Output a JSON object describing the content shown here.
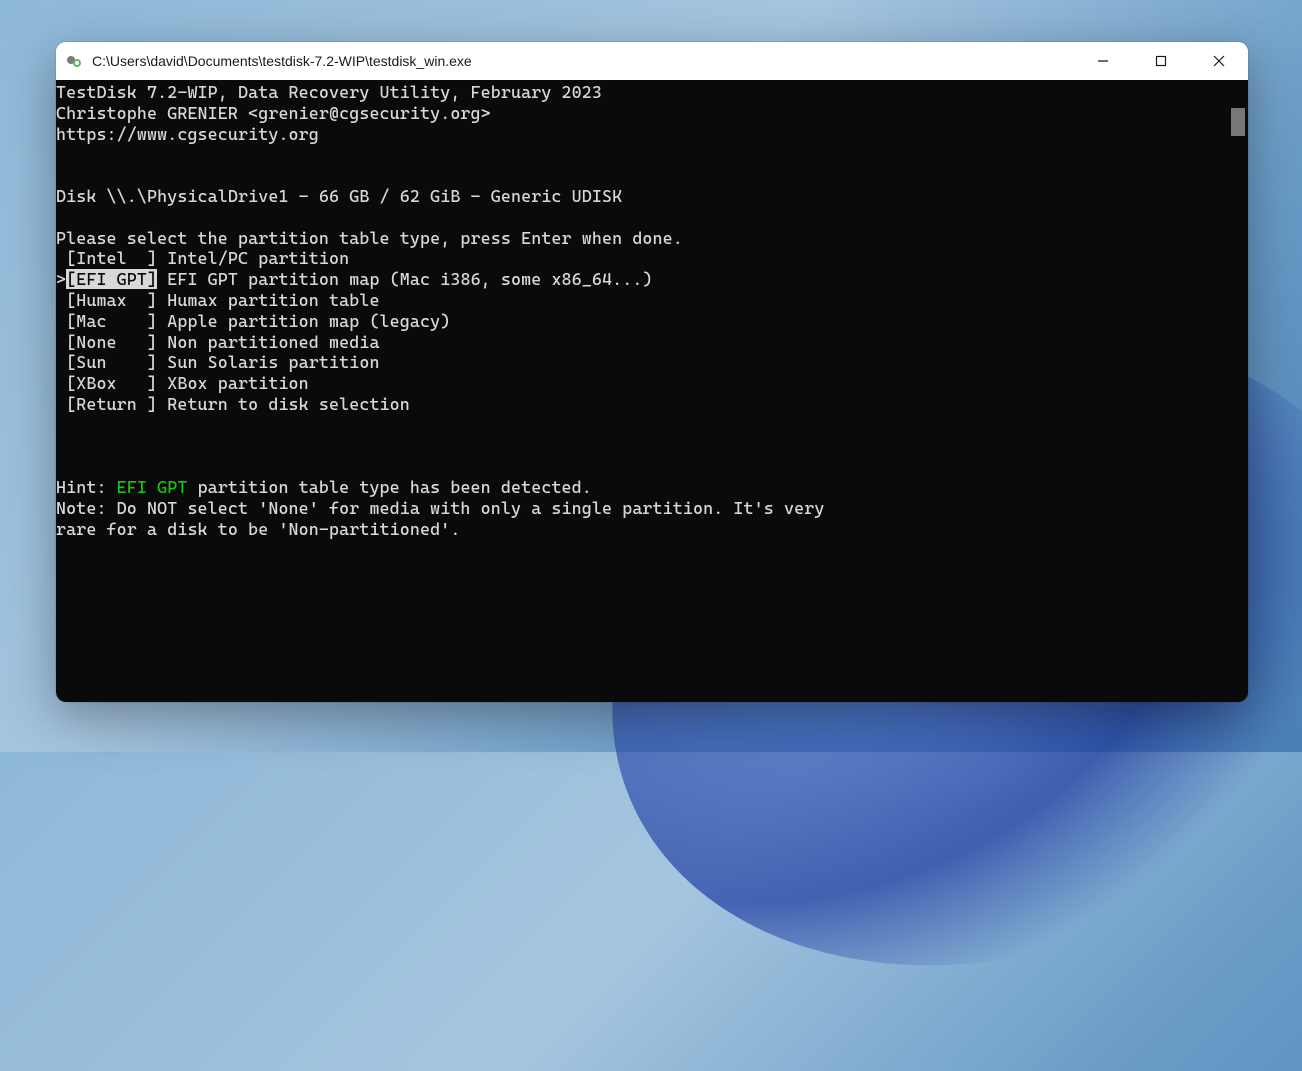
{
  "window": {
    "title": "C:\\Users\\david\\Documents\\testdisk-7.2-WIP\\testdisk_win.exe"
  },
  "header_lines": [
    "TestDisk 7.2-WIP, Data Recovery Utility, February 2023",
    "Christophe GRENIER <grenier@cgsecurity.org>",
    "https://www.cgsecurity.org"
  ],
  "disk_line": "Disk \\\\.\\PhysicalDrive1 - 66 GB / 62 GiB - Generic UDISK",
  "prompt": "Please select the partition table type, press Enter when done.",
  "menu": {
    "items": [
      {
        "label": "Intel  ",
        "desc": "Intel/PC partition",
        "selected": false
      },
      {
        "label": "EFI GPT",
        "desc": "EFI GPT partition map (Mac i386, some x86_64...)",
        "selected": true
      },
      {
        "label": "Humax  ",
        "desc": "Humax partition table",
        "selected": false
      },
      {
        "label": "Mac    ",
        "desc": "Apple partition map (legacy)",
        "selected": false
      },
      {
        "label": "None   ",
        "desc": "Non partitioned media",
        "selected": false
      },
      {
        "label": "Sun    ",
        "desc": "Sun Solaris partition",
        "selected": false
      },
      {
        "label": "XBox   ",
        "desc": "XBox partition",
        "selected": false
      },
      {
        "label": "Return ",
        "desc": "Return to disk selection",
        "selected": false
      }
    ]
  },
  "hint_prefix": "Hint: ",
  "hint_detected": "EFI GPT",
  "hint_suffix": " partition table type has been detected.",
  "note_lines": [
    "Note: Do NOT select 'None' for media with only a single partition. It's very",
    "rare for a disk to be 'Non-partitioned'."
  ]
}
